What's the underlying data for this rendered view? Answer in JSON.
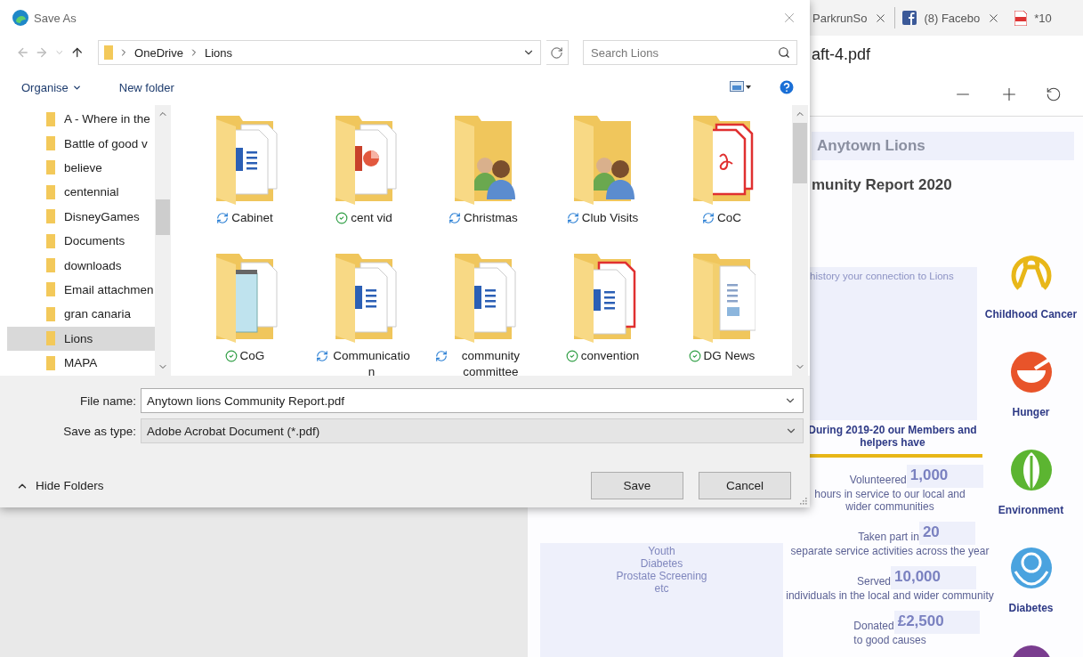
{
  "browser": {
    "tabs": [
      {
        "label": "ParkrunSo",
        "kind": "plain",
        "closable": true
      },
      {
        "label": "(8) Facebo",
        "kind": "social",
        "closable": true
      },
      {
        "label": "*10",
        "kind": "pdf",
        "closable": false
      }
    ],
    "document_title": "aft-4.pdf"
  },
  "pdf": {
    "header": "Anytown Lions",
    "title": "munity Report 2020",
    "intro": "history your connection to Lions",
    "causes_list": [
      "Youth",
      "Diabetes",
      "Prostate Screening",
      "etc"
    ],
    "summary": "During 2019-20 our Members and helpers have",
    "stats": [
      {
        "verb": "Volunteered",
        "value": "1,000",
        "detail_lines": [
          "hours in service to our local and",
          "wider communities"
        ]
      },
      {
        "verb": "Taken part in",
        "value": "20",
        "detail_lines": [
          "separate service activities across the year"
        ]
      },
      {
        "verb": "Served",
        "value": "10,000",
        "detail_lines": [
          "individuals in the local and wider community"
        ]
      },
      {
        "verb": "Donated",
        "value": "£2,500",
        "detail_lines": [
          "to good causes"
        ]
      }
    ],
    "causes": [
      {
        "label": "Childhood Cancer",
        "kind": "ribbon",
        "color": "#e8b718"
      },
      {
        "label": "Hunger",
        "kind": "bowl",
        "color": "#e8542a"
      },
      {
        "label": "Environment",
        "kind": "leaf",
        "color": "#5cb531"
      },
      {
        "label": "Diabetes",
        "kind": "hands",
        "color": "#4aa3df"
      },
      {
        "kind": "eye",
        "color": "#7a3d8f"
      }
    ]
  },
  "dialog": {
    "title": "Save As",
    "breadcrumb": [
      "OneDrive",
      "Lions"
    ],
    "search": {
      "placeholder": "Search Lions"
    },
    "organise": "Organise",
    "new_folder": "New folder",
    "nav_items": [
      {
        "label": "A - Where in the",
        "selected": false
      },
      {
        "label": "Battle of good v",
        "selected": false
      },
      {
        "label": "believe",
        "selected": false
      },
      {
        "label": "centennial",
        "selected": false
      },
      {
        "label": "DisneyGames",
        "selected": false
      },
      {
        "label": "Documents",
        "selected": false
      },
      {
        "label": "downloads",
        "selected": false
      },
      {
        "label": "Email attachmen",
        "selected": false
      },
      {
        "label": "gran canaria",
        "selected": false
      },
      {
        "label": "Lions",
        "selected": true
      },
      {
        "label": "MAPA",
        "selected": false
      }
    ],
    "files": [
      {
        "name": "Cabinet",
        "kind": "word",
        "synced": false
      },
      {
        "name": "cent vid",
        "kind": "slides",
        "synced": true
      },
      {
        "name": "Christmas",
        "kind": "people",
        "synced": false
      },
      {
        "name": "Club Visits",
        "kind": "people",
        "synced": false
      },
      {
        "name": "CoC",
        "kind": "pdf",
        "synced": false
      },
      {
        "name": "CoG",
        "kind": "notes",
        "synced": true
      },
      {
        "name": "Communication",
        "kind": "word",
        "synced": false
      },
      {
        "name": "community committee",
        "kind": "word",
        "synced": false
      },
      {
        "name": "convention",
        "kind": "mixed",
        "synced": true
      },
      {
        "name": "DG News",
        "kind": "plain",
        "synced": true
      }
    ],
    "file_name": {
      "label": "File name:",
      "value": "Anytown lions Community Report.pdf"
    },
    "save_type": {
      "label": "Save as type:",
      "value": "Adobe Acrobat Document (*.pdf)"
    },
    "hide_folders": "Hide Folders",
    "buttons": [
      "Save",
      "Cancel"
    ]
  }
}
